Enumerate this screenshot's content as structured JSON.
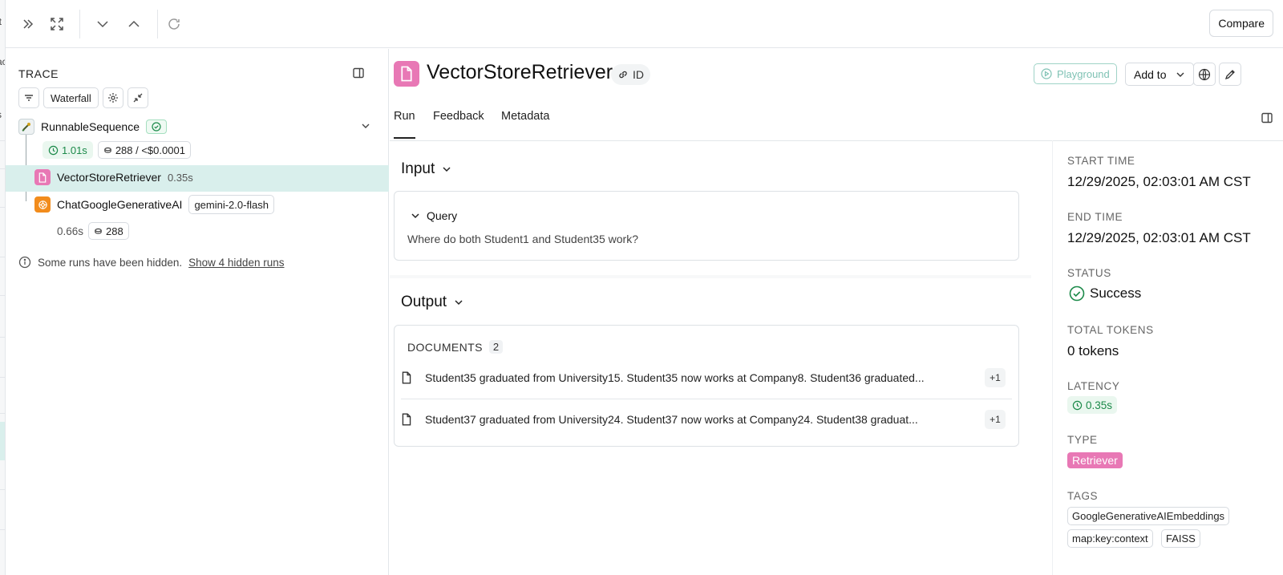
{
  "sliver": {
    "texts": [
      "lt",
      "ac",
      "s"
    ]
  },
  "toolbar": {
    "compare_label": "Compare"
  },
  "trace": {
    "title": "TRACE",
    "view_mode": "Waterfall",
    "runs": [
      {
        "name": "RunnableSequence",
        "latency": "1.01s",
        "tokens": "288 / <$0.0001"
      },
      {
        "name": "VectorStoreRetriever",
        "latency": "0.35s"
      },
      {
        "name": "ChatGoogleGenerativeAI",
        "model": "gemini-2.0-flash",
        "latency": "0.66s",
        "tokens": "288"
      }
    ],
    "hidden_notice": "Some runs have been hidden.",
    "hidden_link": "Show 4 hidden runs"
  },
  "header": {
    "title": "VectorStoreRetriever",
    "id_label": "ID",
    "playground_label": "Playground",
    "add_to_label": "Add to"
  },
  "tabs": [
    {
      "label": "Run",
      "active": true
    },
    {
      "label": "Feedback",
      "active": false
    },
    {
      "label": "Metadata",
      "active": false
    }
  ],
  "input": {
    "heading": "Input",
    "query_label": "Query",
    "query_text": "Where do both Student1 and Student35 work?"
  },
  "output": {
    "heading": "Output",
    "documents_label": "DOCUMENTS",
    "documents_count": "2",
    "documents": [
      {
        "text": "Student35 graduated from University15. Student35 now works at Company8. Student36 graduated...",
        "extra": "+1"
      },
      {
        "text": "Student37 graduated from University24. Student37 now works at Company24. Student38 graduat...",
        "extra": "+1"
      }
    ]
  },
  "meta": {
    "start_time_label": "START TIME",
    "start_time": "12/29/2025, 02:03:01 AM CST",
    "end_time_label": "END TIME",
    "end_time": "12/29/2025, 02:03:01 AM CST",
    "status_label": "STATUS",
    "status": "Success",
    "total_tokens_label": "TOTAL TOKENS",
    "total_tokens": "0 tokens",
    "latency_label": "LATENCY",
    "latency": "0.35s",
    "type_label": "TYPE",
    "type": "Retriever",
    "tags_label": "TAGS",
    "tags": [
      "GoogleGenerativeAIEmbeddings",
      "map:key:context",
      "FAISS"
    ]
  },
  "colors": {
    "selected_row": "#d9efec",
    "retriever": "#e878b5",
    "chat_model": "#f28c1c",
    "success": "#1c8a4a"
  }
}
